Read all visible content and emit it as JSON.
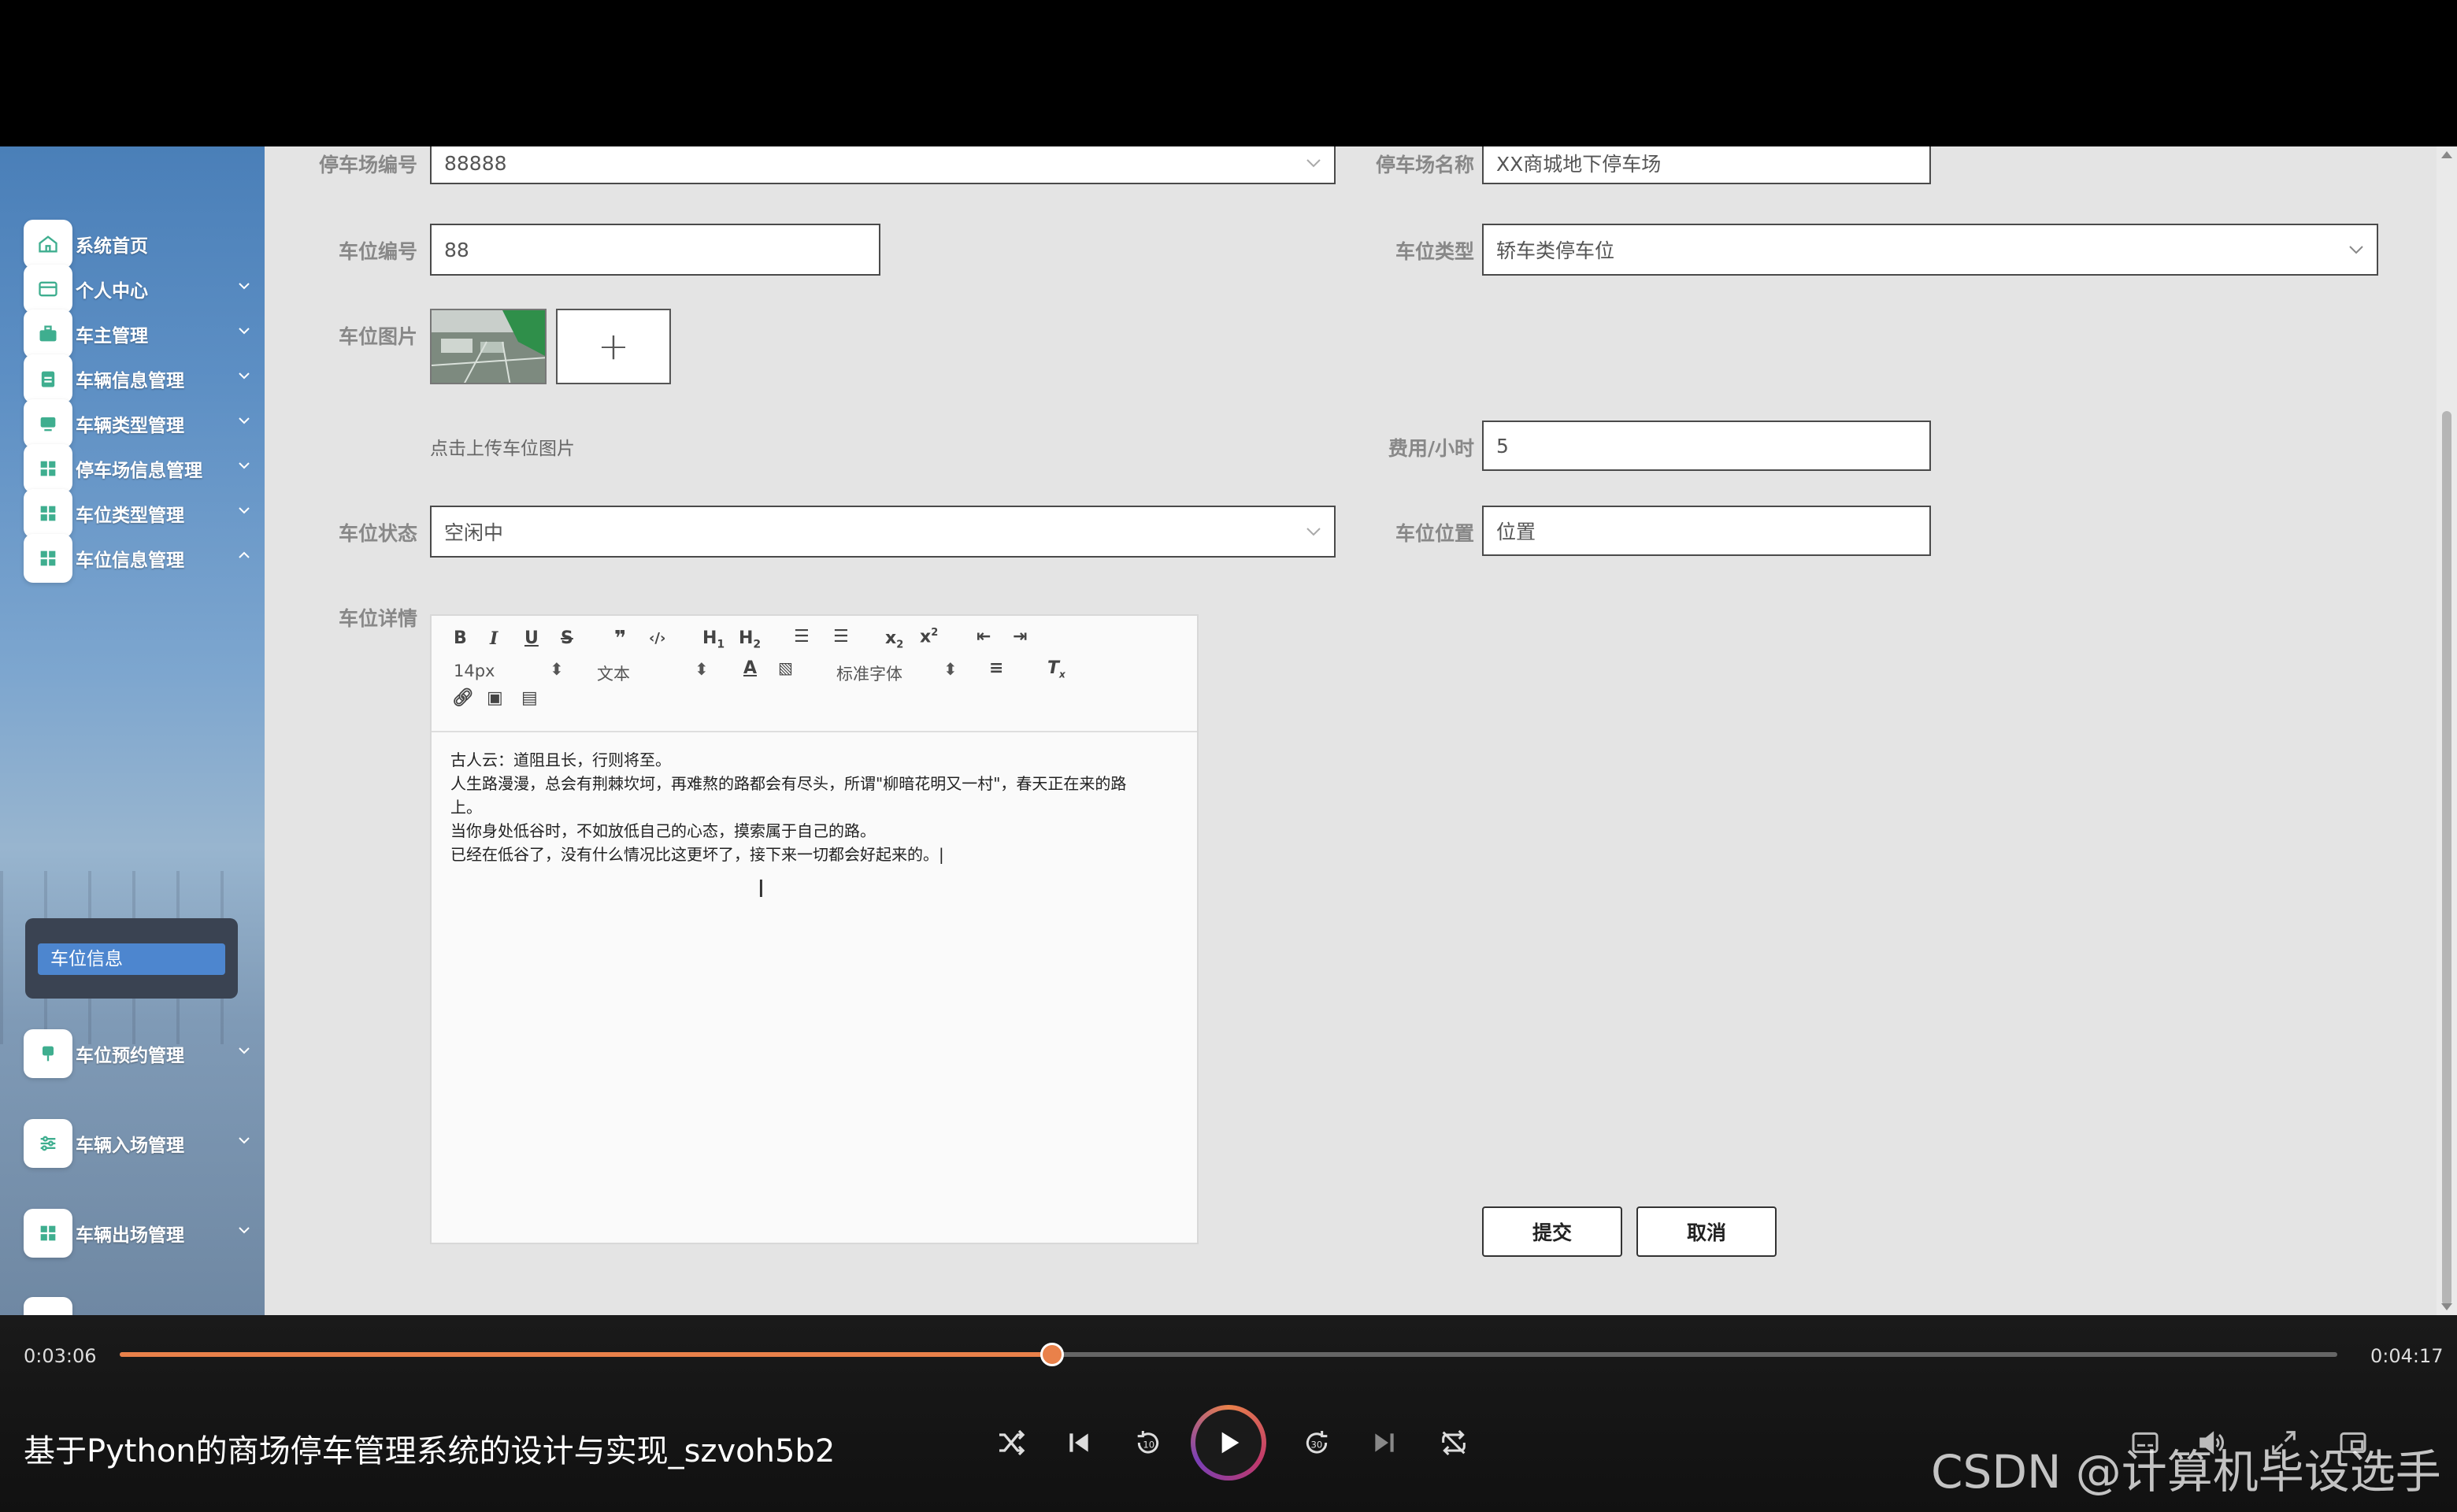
{
  "sidebar": {
    "items": [
      {
        "label": "系统首页",
        "icon": "home-icon"
      },
      {
        "label": "个人中心",
        "icon": "card-icon"
      },
      {
        "label": "车主管理",
        "icon": "briefcase-icon"
      },
      {
        "label": "车辆信息管理",
        "icon": "clipboard-icon"
      },
      {
        "label": "车辆类型管理",
        "icon": "monitor-icon"
      },
      {
        "label": "停车场信息管理",
        "icon": "grid-icon"
      },
      {
        "label": "车位类型管理",
        "icon": "grid-icon"
      },
      {
        "label": "车位信息管理",
        "icon": "grid-icon"
      },
      {
        "label": "车位预约管理",
        "icon": "pin-icon"
      },
      {
        "label": "车辆入场管理",
        "icon": "sliders-icon"
      },
      {
        "label": "车辆出场管理",
        "icon": "grid-icon"
      }
    ],
    "sub_item": "车位信息"
  },
  "form": {
    "lot_no_label": "停车场编号",
    "lot_no_value": "88888",
    "lot_name_label": "停车场名称",
    "lot_name_value": "XX商城地下停车场",
    "spot_no_label": "车位编号",
    "spot_no_value": "88",
    "spot_type_label": "车位类型",
    "spot_type_value": "轿车类停车位",
    "image_label": "车位图片",
    "upload_hint": "点击上传车位图片",
    "upload_plus": "+",
    "fee_label": "费用/小时",
    "fee_value": "5",
    "status_label": "车位状态",
    "status_value": "空闲中",
    "location_label": "车位位置",
    "location_placeholder": "位置",
    "detail_label": "车位详情",
    "submit": "提交",
    "cancel": "取消"
  },
  "editor": {
    "font_size": "14px",
    "text_format": "文本",
    "font_family": "标准字体",
    "content": [
      "古人云：道阻且长，行则将至。",
      "人生路漫漫，总会有荆棘坎坷，再难熬的路都会有尽头，所谓\"柳暗花明又一村\"，春天正在来的路",
      "上。",
      "当你身处低谷时，不如放低自己的心态，摸索属于自己的路。",
      "已经在低谷了，没有什么情况比这更坏了，接下来一切都会好起来的。|"
    ]
  },
  "player": {
    "current_time": "0:03:06",
    "total_time": "0:04:17",
    "progress": 0.4204,
    "title": "基于Python的商场停车管理系统的设计与实现_szvoh5b2",
    "watermark": "CSDN @计算机毕设选手",
    "accent": "#e9814a"
  }
}
